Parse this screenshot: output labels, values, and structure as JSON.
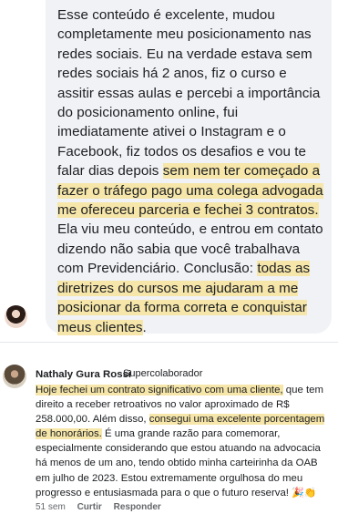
{
  "post": {
    "text_parts": [
      {
        "t": "Esse conteúdo é excelente, mudou completamente meu posicionamento nas redes sociais. Eu na verdade estava sem redes sociais há 2 anos, fiz o curso e assitir essas aulas e percebi a importância do posicionamento online, fui imediatamente ativei o Instagram e o Facebook, fiz todos os desafios e vou te falar dias depois ",
        "h": false
      },
      {
        "t": "sem nem ter começado a fazer o tráfego pago uma colega advogada me ofereceu parceria e fechei 3 contratos.",
        "h": true
      },
      {
        "t": " Ela viu meu conteúdo, e entrou em contato dizendo não sabia que você trabalhava com Previdenciário. Conclusão: ",
        "h": false
      },
      {
        "t": "todas as diretrizes do cursos me ajudaram a me posicionar da forma correta e conquistar meus clientes",
        "h": true
      },
      {
        "t": ".",
        "h": false
      }
    ]
  },
  "comment": {
    "author": "Nathaly Gura Rossi",
    "badge": "Supercolaborador",
    "text_parts": [
      {
        "t": "Hoje fechei um contrato significativo com uma cliente,",
        "h": true
      },
      {
        "t": " que tem direito a receber retroativos no valor aproximado de R$ 258.000,00. Além disso, ",
        "h": false
      },
      {
        "t": "consegui uma excelente porcentagem de honorários.",
        "h": true
      },
      {
        "t": " É uma grande razão para comemorar, especialmente considerando que estou atuando na advocacia há menos de um ano, tendo obtido minha carteirinha da OAB em julho de 2023. Estou extremamente orgulhosa do meu progresso e entusiasmada para o que o futuro reserva! ",
        "h": false
      }
    ],
    "emoji": "🎉👏",
    "time": "51 sem",
    "like_label": "Curtir",
    "reply_label": "Responder"
  }
}
